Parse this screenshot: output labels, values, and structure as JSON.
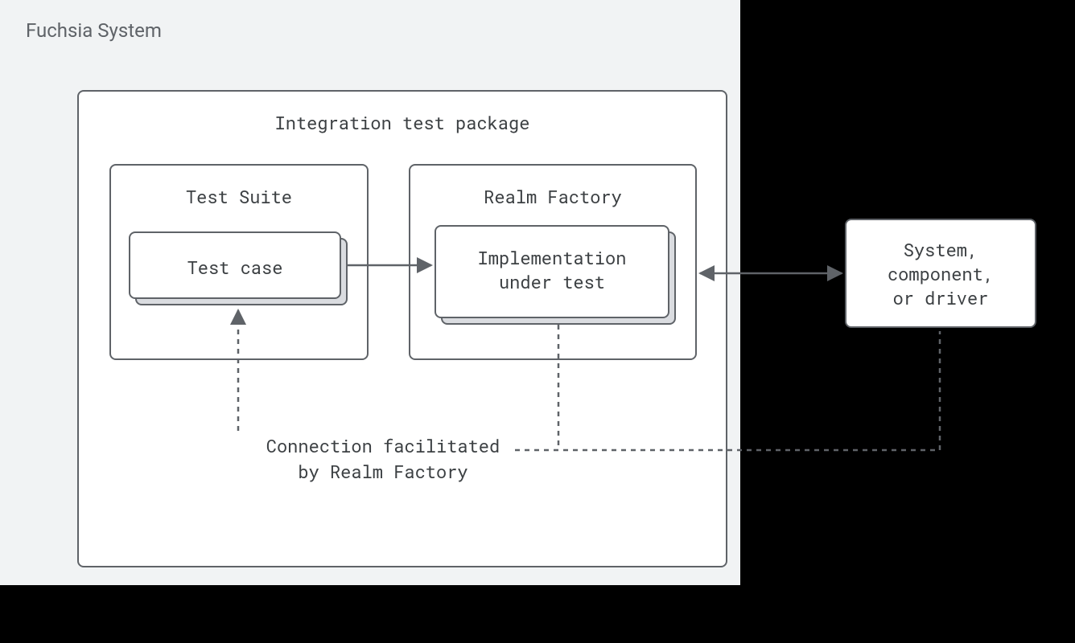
{
  "fuchsia_title": "Fuchsia System",
  "itp_title": "Integration test package",
  "test_suite_title": "Test Suite",
  "test_case_label": "Test case",
  "realm_factory_title": "Realm Factory",
  "implementation_label_line1": "Implementation",
  "implementation_label_line2": "under test",
  "connection_label_line1": "Connection facilitated",
  "connection_label_line2": "by Realm Factory",
  "external_label_line1": "System,",
  "external_label_line2": "component,",
  "external_label_line3": "or driver"
}
